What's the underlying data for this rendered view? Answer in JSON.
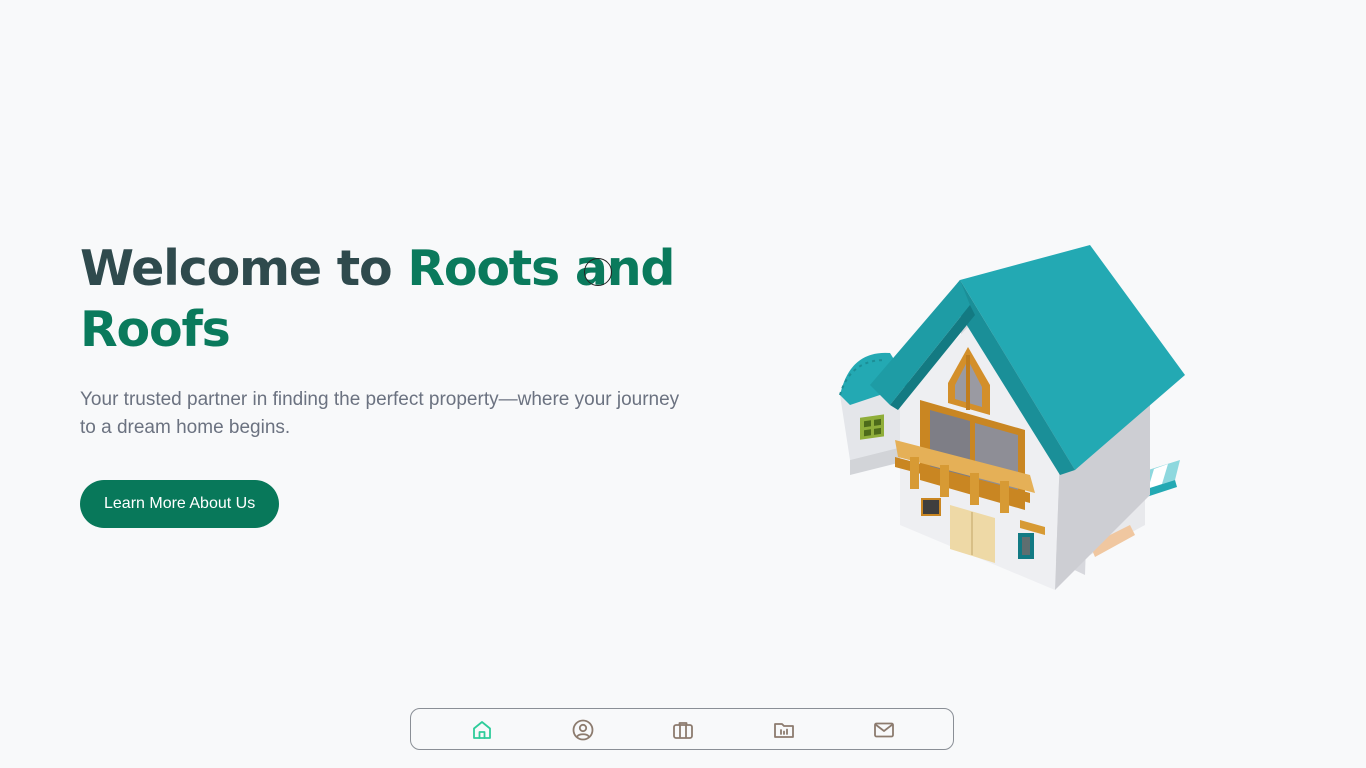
{
  "hero": {
    "title_plain": "Welcome to ",
    "title_accent": "Roots and Roofs",
    "subtitle": "Your trusted partner in finding the perfect property—where your journey to a dream home begins.",
    "cta_label": "Learn More About Us"
  },
  "nav": {
    "items": [
      {
        "icon": "home-icon",
        "active": true
      },
      {
        "icon": "user-circle-icon",
        "active": false
      },
      {
        "icon": "briefcase-icon",
        "active": false
      },
      {
        "icon": "folder-icon",
        "active": false
      },
      {
        "icon": "mail-icon",
        "active": false
      }
    ]
  },
  "colors": {
    "background": "#f8f9fa",
    "title_dark": "#2f4a4d",
    "accent_green": "#0a7a5c",
    "button_bg": "#08785a",
    "subtitle_gray": "#6b7280",
    "nav_active": "#2ecc9a",
    "nav_inactive": "#8c7b6e",
    "roof_teal": "#23a9b3"
  }
}
